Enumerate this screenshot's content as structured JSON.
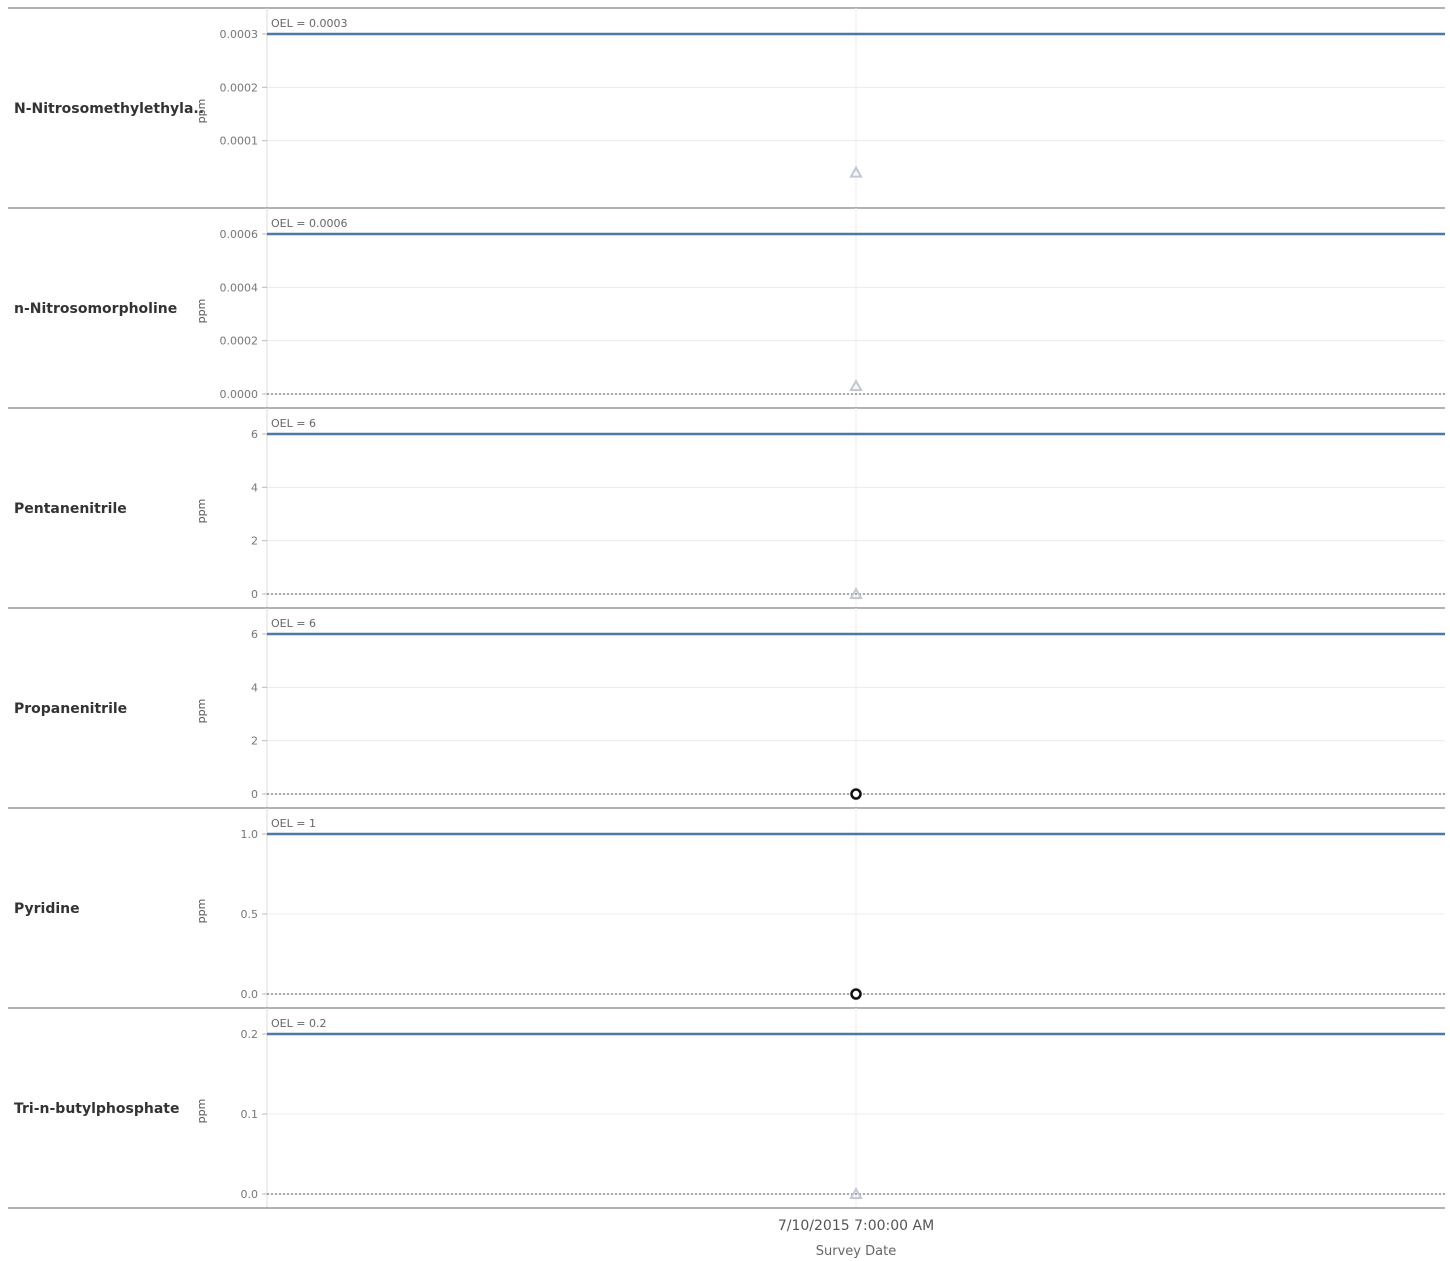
{
  "chart_data": {
    "type": "scatter",
    "x_axis": {
      "title": "Survey Date",
      "tick_label": "7/10/2015 7:00:00 AM",
      "value": "7/10/2015 7:00:00 AM"
    },
    "y_unit": "ppm",
    "rows": [
      {
        "name": "N-Nitrosomethylethyla..",
        "ylim": [
          0,
          0.0003
        ],
        "ticks": [
          "0.0001",
          "0.0002",
          "0.0003"
        ],
        "tick_values": [
          0.0001,
          0.0002,
          0.0003
        ],
        "oel": 0.0003,
        "oel_label": "OEL = 0.0003",
        "zero_line": false,
        "points": [
          {
            "x": "7/10/2015 7:00:00 AM",
            "y": 4e-05,
            "marker": "triangle"
          }
        ]
      },
      {
        "name": "n-Nitrosomorpholine",
        "ylim": [
          0,
          0.0006
        ],
        "ticks": [
          "0.0000",
          "0.0002",
          "0.0004",
          "0.0006"
        ],
        "tick_values": [
          0,
          0.0002,
          0.0004,
          0.0006
        ],
        "oel": 0.0006,
        "oel_label": "OEL = 0.0006",
        "zero_line": true,
        "points": [
          {
            "x": "7/10/2015 7:00:00 AM",
            "y": 3e-05,
            "marker": "triangle"
          }
        ]
      },
      {
        "name": "Pentanenitrile",
        "ylim": [
          0,
          6
        ],
        "ticks": [
          "0",
          "2",
          "4",
          "6"
        ],
        "tick_values": [
          0,
          2,
          4,
          6
        ],
        "oel": 6,
        "oel_label": "OEL = 6",
        "zero_line": true,
        "points": [
          {
            "x": "7/10/2015 7:00:00 AM",
            "y": 0,
            "marker": "triangle"
          }
        ]
      },
      {
        "name": "Propanenitrile",
        "ylim": [
          0,
          6
        ],
        "ticks": [
          "0",
          "2",
          "4",
          "6"
        ],
        "tick_values": [
          0,
          2,
          4,
          6
        ],
        "oel": 6,
        "oel_label": "OEL = 6",
        "zero_line": true,
        "points": [
          {
            "x": "7/10/2015 7:00:00 AM",
            "y": 0,
            "marker": "circle"
          }
        ]
      },
      {
        "name": "Pyridine",
        "ylim": [
          0,
          1
        ],
        "ticks": [
          "0.0",
          "0.5",
          "1.0"
        ],
        "tick_values": [
          0,
          0.5,
          1
        ],
        "oel": 1,
        "oel_label": "OEL = 1",
        "zero_line": true,
        "points": [
          {
            "x": "7/10/2015 7:00:00 AM",
            "y": 0,
            "marker": "circle"
          }
        ]
      },
      {
        "name": "Tri-n-butylphosphate",
        "ylim": [
          0,
          0.2
        ],
        "ticks": [
          "0.0",
          "0.1",
          "0.2"
        ],
        "tick_values": [
          0,
          0.1,
          0.2
        ],
        "oel": 0.2,
        "oel_label": "OEL = 0.2",
        "zero_line": true,
        "points": [
          {
            "x": "7/10/2015 7:00:00 AM",
            "y": 0,
            "marker": "triangle"
          }
        ]
      }
    ],
    "colors": {
      "oel_line": "#4e79a7",
      "triangle_marker": "#c0c8d4",
      "circle_marker": "#111111",
      "gridline": "#ececec",
      "divider": "#666666"
    }
  }
}
